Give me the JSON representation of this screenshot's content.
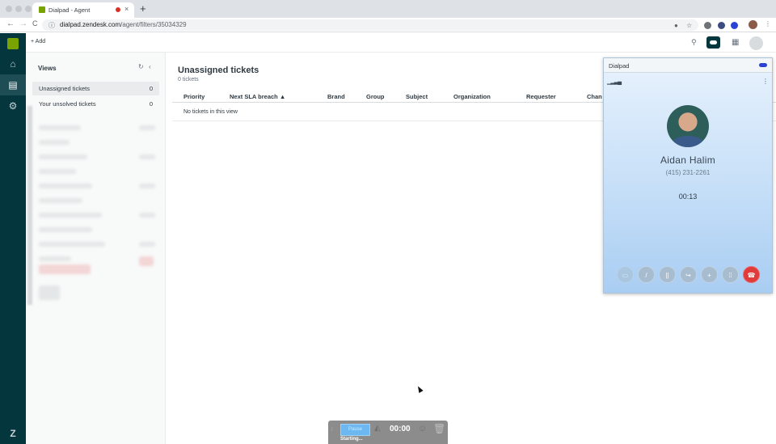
{
  "browser": {
    "tab_title": "Dialpad - Agent",
    "tab_close": "×",
    "new_tab": "+",
    "url_host": "dialpad.zendesk.com",
    "url_path": "/agent/filters/35034329",
    "nav_back": "←",
    "nav_forward": "→",
    "nav_reload": "C",
    "lock": "ⓘ"
  },
  "header": {
    "add_label": "+ Add",
    "search_icon": "⚲",
    "apps_icon": "▦"
  },
  "leftnav": {
    "items": [
      {
        "name": "home",
        "icon": "⌂"
      },
      {
        "name": "views",
        "icon": "▤"
      },
      {
        "name": "admin",
        "icon": "⚙"
      }
    ],
    "footer_icon": "Z"
  },
  "views": {
    "heading": "Views",
    "refresh_icon": "↻",
    "collapse_icon": "‹",
    "items": [
      {
        "label": "Unassigned tickets",
        "count": "0"
      },
      {
        "label": "Your unsolved tickets",
        "count": "0"
      }
    ]
  },
  "main": {
    "title": "Unassigned tickets",
    "subtitle": "0 tickets",
    "columns": [
      "Priority",
      "Next SLA breach ▲",
      "Brand",
      "Group",
      "Subject",
      "Organization",
      "Requester",
      "Chan"
    ],
    "empty_message": "No tickets in this view"
  },
  "dialpad": {
    "title": "Dialpad",
    "signal_icon": "▁▂▃▄",
    "menu_icon": "⋮",
    "contact_name": "Aidan Halim",
    "contact_phone": "(415) 231-2261",
    "call_timer": "00:13",
    "buttons": [
      {
        "name": "video",
        "icon": "▭"
      },
      {
        "name": "mute",
        "icon": "/"
      },
      {
        "name": "hold",
        "icon": "||"
      },
      {
        "name": "transfer",
        "icon": "↪"
      },
      {
        "name": "add-caller",
        "icon": "+"
      },
      {
        "name": "keypad",
        "icon": "⁞⁞"
      },
      {
        "name": "hangup",
        "icon": "☎"
      }
    ],
    "accent_color": "#2a43d6",
    "hangup_color": "#e03c3c"
  },
  "recorder": {
    "pause_label": "Pause",
    "time": "00:00",
    "status": "Starting...",
    "trash_icon": "🗑",
    "camera_icon": "◭",
    "emoji_icon": "☺"
  }
}
